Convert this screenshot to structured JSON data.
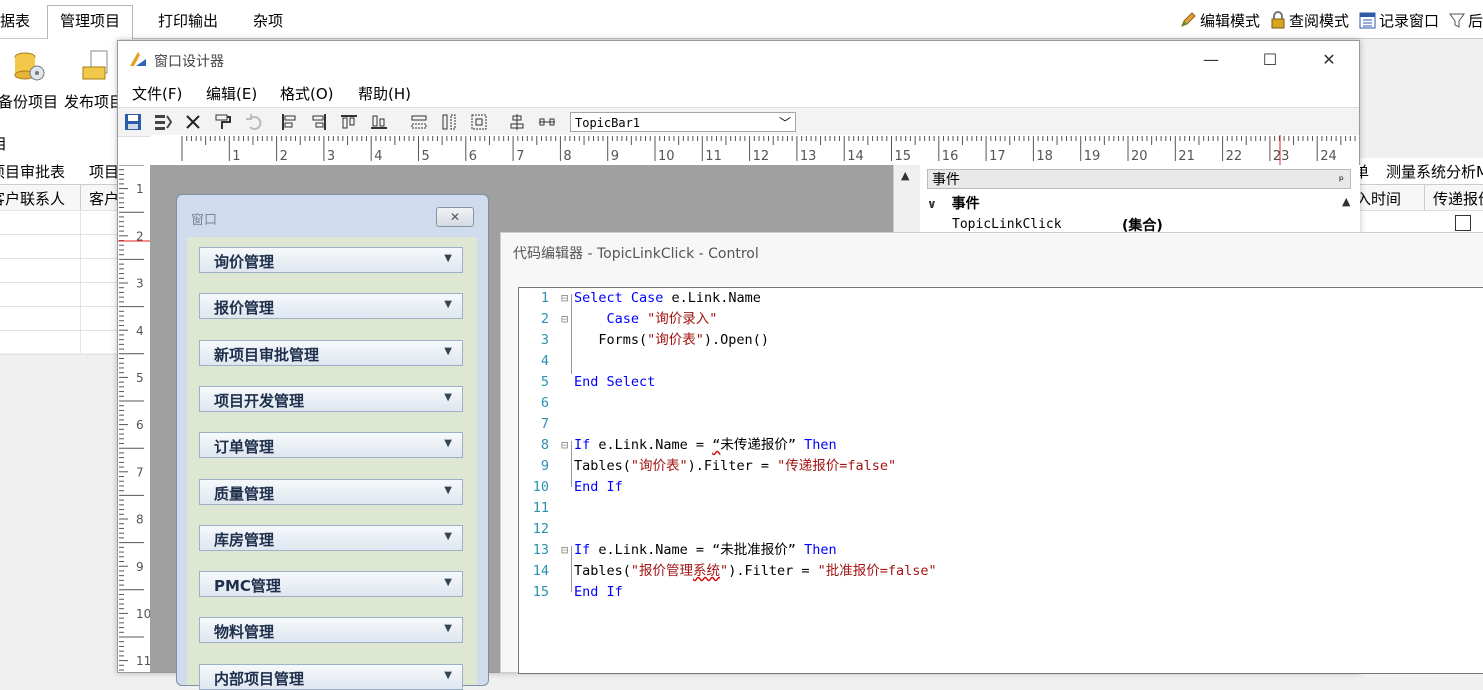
{
  "app": {
    "tabs": [
      "据表",
      "管理项目",
      "打印输出",
      "杂项"
    ],
    "active_tab": "管理项目",
    "modes": [
      {
        "icon": "pencil-icon",
        "label": "编辑模式"
      },
      {
        "icon": "lock-icon",
        "label": "查阅模式"
      },
      {
        "icon": "window-icon",
        "label": "记录窗口"
      },
      {
        "icon": "filter-icon",
        "label": "后"
      }
    ],
    "ribbon": [
      {
        "icon": "backup-db-icon",
        "label": "备份项目"
      },
      {
        "icon": "publish-icon",
        "label": "发布项目"
      }
    ],
    "ribbon_group": "目",
    "left_grid": {
      "headers_row1": [
        "项目审批表",
        "项目"
      ],
      "headers_row2": [
        "客户联系人",
        "客户"
      ]
    },
    "right_grid": {
      "headers_row1": [
        "单",
        "测量系统分析M"
      ],
      "headers_row2": [
        "入时间",
        "传递报价"
      ]
    }
  },
  "designer": {
    "title": "窗口设计器",
    "window_controls": {
      "minimize": "—",
      "maximize": "☐",
      "close": "✕"
    },
    "menu": [
      "文件(F)",
      "编辑(E)",
      "格式(O)",
      "帮助(H)"
    ],
    "control_select": "TopicBar1",
    "ruler_h": [
      "1",
      "2",
      "3",
      "4",
      "5",
      "6",
      "7",
      "8",
      "9",
      "10",
      "11",
      "12",
      "13",
      "14",
      "15",
      "16",
      "17",
      "18",
      "19",
      "20",
      "21",
      "22",
      "23",
      "24"
    ],
    "ruler_v": [
      "1",
      "2",
      "3",
      "4",
      "5",
      "6",
      "7",
      "8",
      "9",
      "10",
      "11"
    ],
    "inner_window": {
      "title": "窗口",
      "close": "✕",
      "topics": [
        "询价管理",
        "报价管理",
        "新项目审批管理",
        "项目开发管理",
        "订单管理",
        "质量管理",
        "库房管理",
        "PMC管理",
        "物料管理",
        "内部项目管理"
      ]
    },
    "properties": {
      "pane_title": "事件",
      "pin": "ᵖ",
      "category": "事件",
      "row_name": "TopicLinkClick",
      "row_value": "(集合)"
    }
  },
  "code_editor": {
    "title": "代码编辑器 - TopicLinkClick - Control",
    "line_numbers": [
      "1",
      "2",
      "3",
      "4",
      "5",
      "6",
      "7",
      "8",
      "9",
      "10",
      "11",
      "12",
      "13",
      "14",
      "15"
    ]
  },
  "colors": {
    "keyword": "#0000ff",
    "string": "#a31515",
    "line_number": "#2b91af",
    "topic_text": "#1e2f4c"
  }
}
